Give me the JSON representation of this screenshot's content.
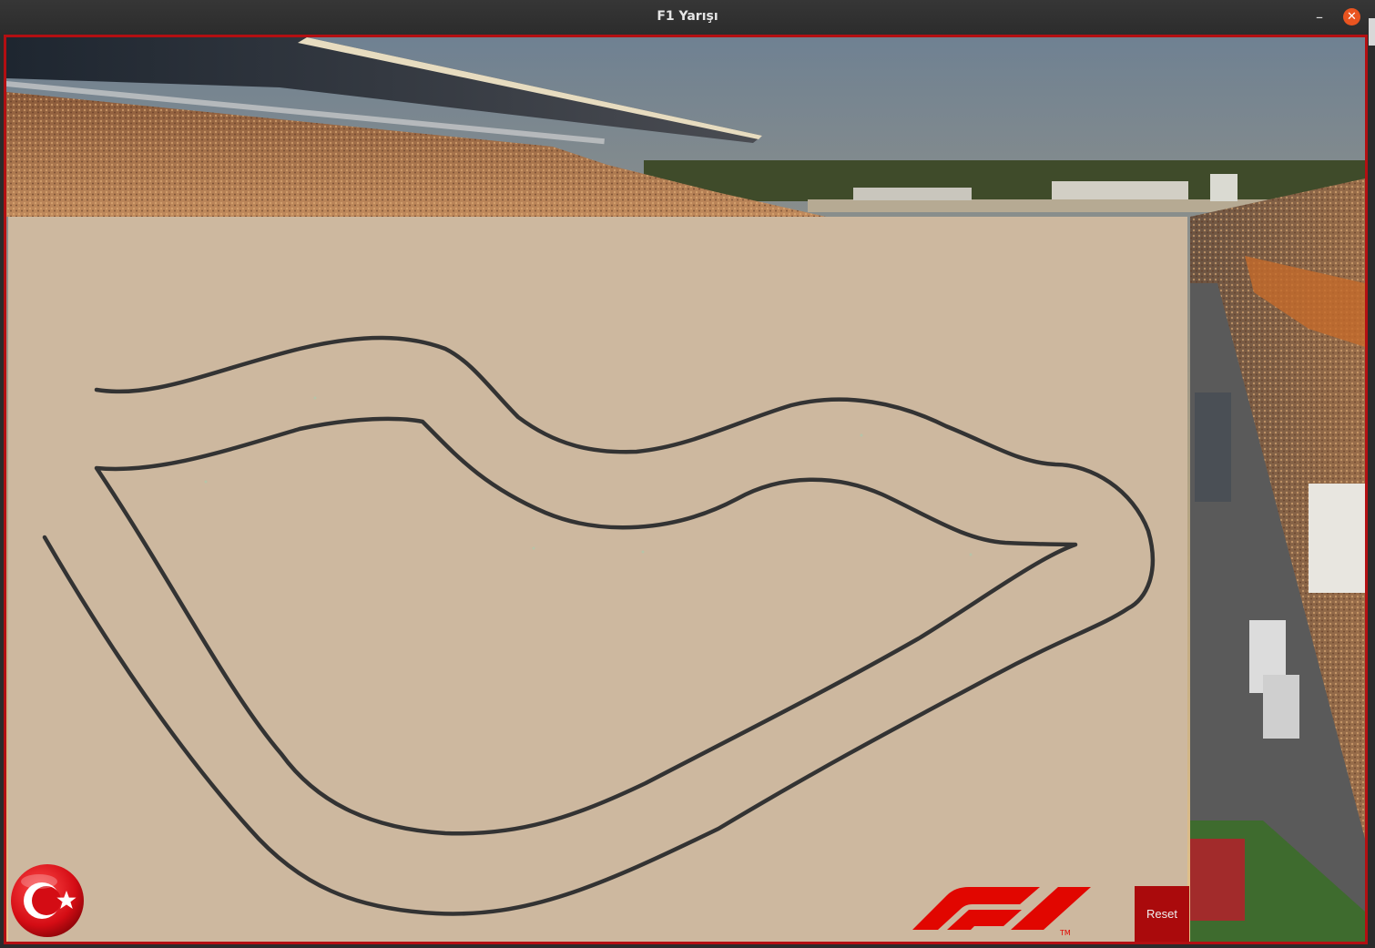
{
  "window": {
    "title": "F1 Yarışı",
    "minimize_symbol": "–",
    "close_symbol": "✕"
  },
  "controls": {
    "reset_label": "Reset"
  },
  "icons": {
    "flag": "turkey-flag-icon",
    "logo": "f1-logo-icon",
    "logo_mark": "TM"
  },
  "colors": {
    "frame_border": "#b30f12",
    "track_surface": "#cdb89f",
    "track_line": "#333333",
    "reset_bg": "#aa0a0c"
  }
}
